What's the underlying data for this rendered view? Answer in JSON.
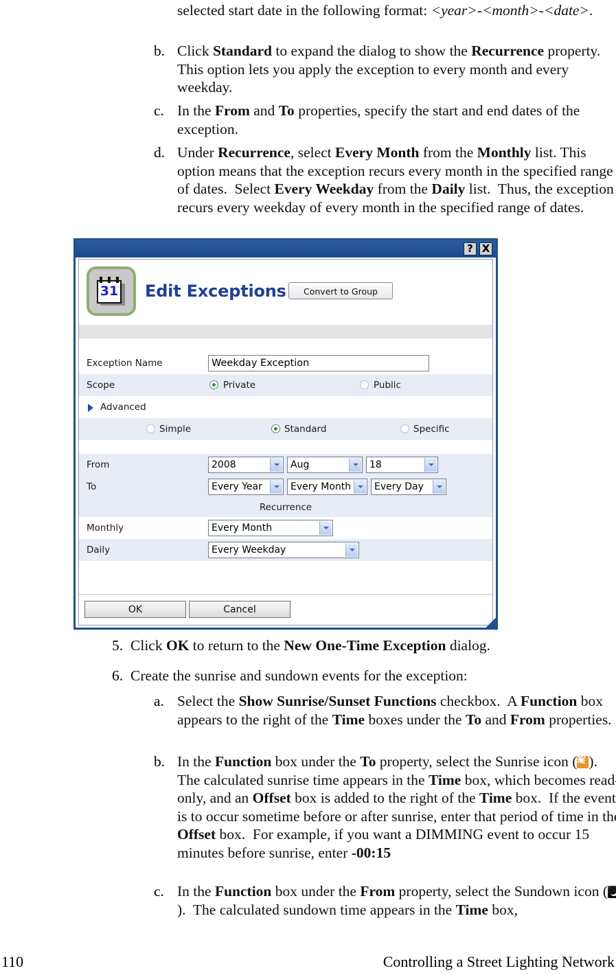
{
  "body_text": {
    "item_a_continued": "selected start date in the following format: <year>-<month>-<date>.",
    "marker_b": "b.",
    "item_b": "Click Standard to expand the dialog to show the Recurrence property.  This option lets you apply the exception to every month and every weekday.",
    "marker_c": "c.",
    "item_c": "In the From and To properties, specify the start and end dates of the exception.",
    "marker_d": "d.",
    "item_d": "Under Recurrence, select Every Month from the Monthly list.  This option means that the exception recurs every month in the specified range of dates.  Select Every Weekday from the Daily list.  Thus, the exception recurs every weekday of every month in the specified range of dates.",
    "marker_5": "5.",
    "item_5": "Click OK to return to the New One-Time Exception dialog.",
    "marker_6": "6.",
    "item_6": "Create the sunrise and sundown events for the exception:",
    "marker_a2": "a.",
    "item_a2": "Select the Show Sunrise/Sunset Functions checkbox.  A Function box appears to the right of the Time boxes under the To and From properties.",
    "marker_b2": "b.",
    "item_b2": "In the Function box under the To property, select the Sunrise icon ( ).  The calculated sunrise time appears in the Time box, which becomes read-only, and an Offset box is added to the right of the Time box.  If the event is to occur sometime before or after sunrise, enter that period of time in the Offset box.  For example, if you want a DIMMING event to occur 15 minutes before sunrise, enter -00:15",
    "marker_c2": "c.",
    "item_c2": "In the Function box under the From property, select the Sundown icon ( ).  The calculated sundown time appears in the Time box,"
  },
  "footer": {
    "page_number": "110",
    "title": "Controlling a Street Lighting Network"
  },
  "dialog": {
    "titlebar": {
      "help_label": "?",
      "close_label": "X"
    },
    "header": {
      "icon_day": "31",
      "title": "Edit Exceptions",
      "convert_button": "Convert to Group"
    },
    "fields": {
      "exception_name_label": "Exception Name",
      "exception_name_value": "Weekday Exception",
      "scope_label": "Scope",
      "scope_private": "Private",
      "scope_public": "Public",
      "advanced_label": "Advanced",
      "mode_simple": "Simple",
      "mode_standard": "Standard",
      "mode_specific": "Specific",
      "from_label": "From",
      "from_year": "2008",
      "from_month": "Aug",
      "from_day": "18",
      "to_label": "To",
      "to_year": "Every Year",
      "to_month": "Every Month",
      "to_day": "Every Day",
      "recurrence_label": "Recurrence",
      "monthly_label": "Monthly",
      "monthly_value": "Every Month",
      "daily_label": "Daily",
      "daily_value": "Every Weekday"
    },
    "buttons": {
      "ok": "OK",
      "cancel": "Cancel"
    },
    "colors": {
      "titlebar": "#21508e",
      "title_text": "#1f3f97",
      "row_tint": "#e8ecf5",
      "radio_dot": "#1ea21e",
      "calendar_border": "#8fae77"
    }
  }
}
